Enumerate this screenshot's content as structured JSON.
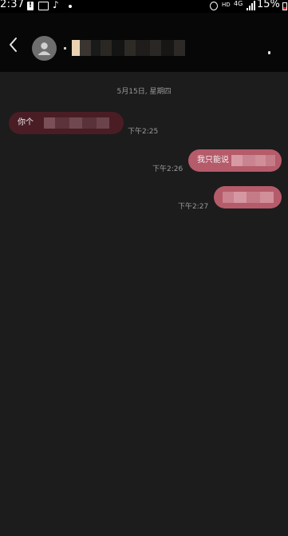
{
  "status_bar": {
    "time": "2:37",
    "alert_glyph": "!",
    "tiktok_glyph": "♪",
    "hd_label": "HD",
    "data_label": "4G",
    "battery_percent": "15%",
    "battery_level": 0.15,
    "battery_fill_color": "#e02020"
  },
  "header": {
    "back_icon": "chevron-left-icon",
    "avatar_icon": "person-icon",
    "contact_name_redacted": true
  },
  "conversation": {
    "date_separator": "5月15日, 星期四",
    "messages": [
      {
        "direction": "incoming",
        "text": "你个",
        "time": "下午2:25",
        "bubble_color": "#4a1d24"
      },
      {
        "direction": "outgoing",
        "text": "我只能说",
        "time": "下午2:26",
        "bubble_color": "#b55b6a"
      },
      {
        "direction": "outgoing",
        "text": "",
        "time": "下午2:27",
        "bubble_color": "#b55b6a"
      }
    ]
  }
}
